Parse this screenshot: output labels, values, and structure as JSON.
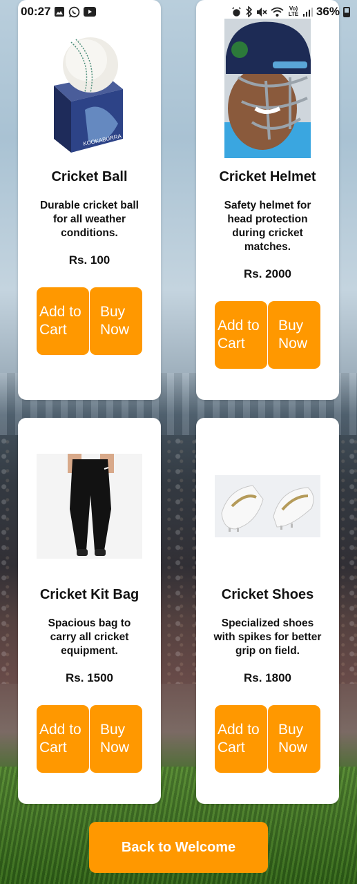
{
  "status_bar": {
    "time": "00:27",
    "battery": "36%",
    "network": "Vo) LTE"
  },
  "products": [
    {
      "title": "Cricket Ball",
      "description": "Durable cricket ball for all weather conditions.",
      "price": "Rs. 100",
      "add_label": "Add to Cart",
      "buy_label": "Buy Now",
      "image_icon": "cricket-ball-image"
    },
    {
      "title": "Cricket Helmet",
      "description": "Safety helmet for head protection during cricket matches.",
      "price": "Rs. 2000",
      "add_label": "Add to Cart",
      "buy_label": "Buy Now",
      "image_icon": "cricket-helmet-image"
    },
    {
      "title": "Cricket Kit Bag",
      "description": "Spacious bag to carry all cricket equipment.",
      "price": "Rs. 1500",
      "add_label": "Add to Cart",
      "buy_label": "Buy Now",
      "image_icon": "track-pants-image"
    },
    {
      "title": "Cricket Shoes",
      "description": "Specialized shoes with spikes for better grip on field.",
      "price": "Rs. 1800",
      "add_label": "Add to Cart",
      "buy_label": "Buy Now",
      "image_icon": "cricket-shoes-image"
    }
  ],
  "back_button": "Back to Welcome",
  "colors": {
    "accent": "#ff9800",
    "card": "#ffffff",
    "text": "#111111"
  }
}
